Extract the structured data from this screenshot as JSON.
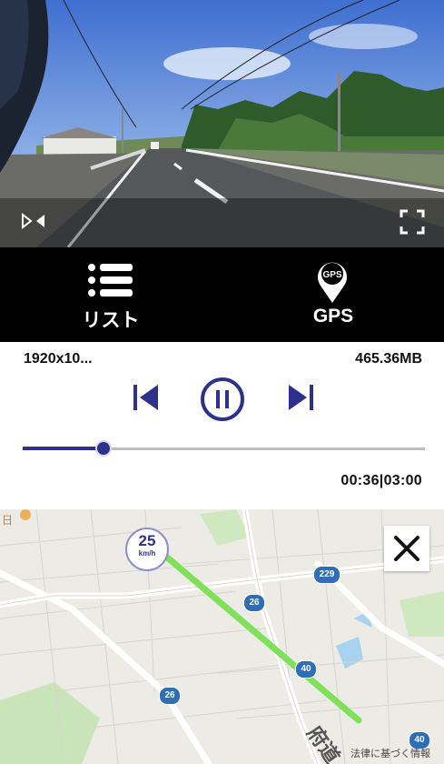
{
  "video": {
    "flip_icon": "flip-horizontal-icon",
    "fullscreen_icon": "fullscreen-icon"
  },
  "toolbar": {
    "list_label": "リスト",
    "list_icon": "list-icon",
    "gps_label": "GPS",
    "gps_icon": "gps-pin-icon",
    "gps_pin_text": "GPS"
  },
  "info": {
    "resolution": "1920x10...",
    "file_size": "465.36MB"
  },
  "playback": {
    "prev_icon": "skip-previous-icon",
    "pause_icon": "pause-icon",
    "next_icon": "skip-next-icon",
    "progress_fraction": 0.2,
    "time": "00:36|03:00"
  },
  "map": {
    "speed_value": "25",
    "speed_unit": "km/h",
    "route_badges": [
      "229",
      "26",
      "40",
      "26",
      "40"
    ],
    "road_label": "府道",
    "attribution": "法律に基づく情報",
    "close_icon": "close-icon",
    "accent": "#2e318c",
    "route_color": "#7fe05a"
  }
}
